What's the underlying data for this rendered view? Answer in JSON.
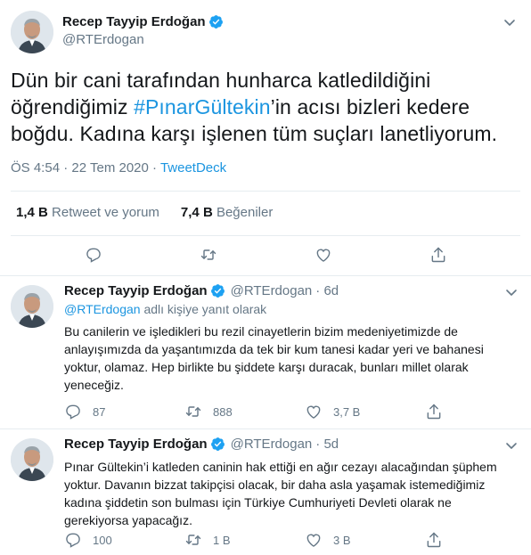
{
  "main_tweet": {
    "author_name": "Recep Tayyip Erdoğan",
    "author_handle": "@RTErdogan",
    "text_before": "Dün bir cani tarafından hunharca katledildiğini öğrendiğimiz ",
    "hashtag": "#PınarGültekin",
    "text_after": "’in acısı bizleri kedere boğdu. Kadına karşı işlenen tüm suçları lanetliyorum.",
    "time": "ÖS 4:54",
    "separator": "·",
    "date": "22 Tem 2020",
    "source": "TweetDeck",
    "retweets_count": "1,4 B",
    "retweets_label": "Retweet ve yorum",
    "likes_count": "7,4 B",
    "likes_label": "Beğeniler"
  },
  "replies": [
    {
      "author_name": "Recep Tayyip Erdoğan",
      "author_handle": "@RTErdogan",
      "age": "· 6d",
      "replying_to_handle": "@RTErdogan",
      "replying_to_text": "adlı kişiye yanıt olarak",
      "text": "Bu canilerin ve işledikleri bu rezil cinayetlerin bizim medeniyetimizde de anlayışımızda da yaşantımızda da tek bir kum tanesi kadar yeri ve bahanesi yoktur, olamaz. Hep birlikte bu şiddete karşı duracak, bunları millet olarak yeneceğiz.",
      "reply_count": "87",
      "retweet_count": "888",
      "like_count": "3,7 B"
    },
    {
      "author_name": "Recep Tayyip Erdoğan",
      "author_handle": "@RTErdogan",
      "age": "· 5d",
      "text": "Pınar Gültekin’i katleden caninin hak ettiği en ağır cezayı alacağından şüphem yoktur. Davanın bizzat takipçisi olacak, bir daha asla yaşamak istemediğimiz kadına şiddetin son bulması için Türkiye Cumhuriyeti Devleti olarak ne gerekiyorsa yapacağız.",
      "reply_count": "100",
      "retweet_count": "1 B",
      "like_count": "3 B"
    }
  ],
  "icons": {
    "verified": "verified-badge-icon",
    "caret": "chevron-down-icon",
    "reply": "reply-icon",
    "retweet": "retweet-icon",
    "like": "heart-icon",
    "share": "share-icon"
  },
  "colors": {
    "link": "#1b95e0",
    "verified": "#1da1f2",
    "muted": "#657786",
    "text": "#14171a"
  }
}
